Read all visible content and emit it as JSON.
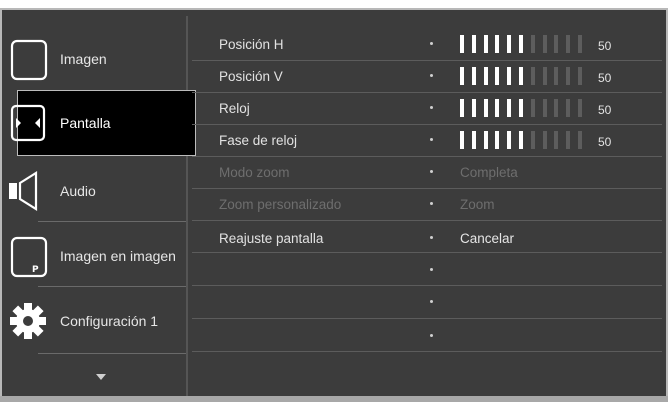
{
  "sidebar": {
    "items": [
      {
        "label": "Imagen",
        "icon": "monitor-icon"
      },
      {
        "label": "Pantalla",
        "icon": "screen-arrows-icon",
        "selected": true
      },
      {
        "label": "Audio",
        "icon": "speaker-icon"
      },
      {
        "label": "Imagen en imagen",
        "icon": "pip-icon"
      },
      {
        "label": "Configuración 1",
        "icon": "gear-icon"
      }
    ],
    "scroll_icon": "chevron-down-icon"
  },
  "settings": {
    "rows": [
      {
        "label": "Posición H",
        "type": "slider",
        "value": "50",
        "level": 0.5
      },
      {
        "label": "Posición V",
        "type": "slider",
        "value": "50",
        "level": 0.5
      },
      {
        "label": "Reloj",
        "type": "slider",
        "value": "50",
        "level": 0.5
      },
      {
        "label": "Fase de reloj",
        "type": "slider",
        "value": "50",
        "level": 0.5
      },
      {
        "label": "Modo zoom",
        "type": "text",
        "value": "Completa",
        "disabled": true
      },
      {
        "label": "Zoom personalizado",
        "type": "text",
        "value": "Zoom",
        "disabled": true
      },
      {
        "label": "Reajuste pantalla",
        "type": "text",
        "value": "Cancelar"
      },
      {
        "label": "",
        "type": "empty",
        "value": ""
      },
      {
        "label": "",
        "type": "empty",
        "value": ""
      },
      {
        "label": "",
        "type": "empty",
        "value": ""
      }
    ]
  },
  "colors": {
    "background": "#3c3c3c",
    "selected_bg": "#000000",
    "text": "#e6e6e6",
    "disabled_text": "#6e6e6e",
    "slider_on": "#ffffff",
    "slider_off": "#5d5d5d"
  }
}
